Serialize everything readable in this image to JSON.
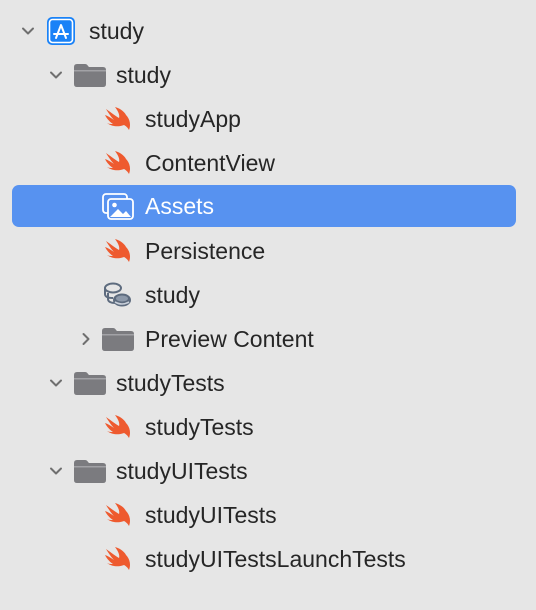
{
  "navigator": {
    "items": [
      {
        "label": "study",
        "kind": "project",
        "level": 0,
        "expanded": true
      },
      {
        "label": "study",
        "kind": "folder",
        "level": 1,
        "expanded": true
      },
      {
        "label": "studyApp",
        "kind": "swift",
        "level": 2
      },
      {
        "label": "ContentView",
        "kind": "swift",
        "level": 2
      },
      {
        "label": "Assets",
        "kind": "assets",
        "level": 2,
        "selected": true
      },
      {
        "label": "Persistence",
        "kind": "swift",
        "level": 2
      },
      {
        "label": "study",
        "kind": "coredata",
        "level": 2
      },
      {
        "label": "Preview Content",
        "kind": "folder",
        "level": 2,
        "expanded": false
      },
      {
        "label": "studyTests",
        "kind": "folder",
        "level": 1,
        "expanded": true
      },
      {
        "label": "studyTests",
        "kind": "swift",
        "level": 2
      },
      {
        "label": "studyUITests",
        "kind": "folder",
        "level": 1,
        "expanded": true
      },
      {
        "label": "studyUITests",
        "kind": "swift",
        "level": 2
      },
      {
        "label": "studyUITestsLaunchTests",
        "kind": "swift",
        "level": 2
      }
    ]
  },
  "colors": {
    "sidebar_bg": "#e6e6e6",
    "selection": "#5792f0",
    "swift": "#ee5a2f",
    "folder": "#7b7b7f",
    "project": "#1a82f7"
  },
  "icons": {
    "project": "xcode-project-icon",
    "folder": "folder-icon",
    "swift": "swift-file-icon",
    "assets": "asset-catalog-icon",
    "coredata": "core-data-model-icon",
    "chevron_down": "chevron-down-icon",
    "chevron_right": "chevron-right-icon"
  }
}
